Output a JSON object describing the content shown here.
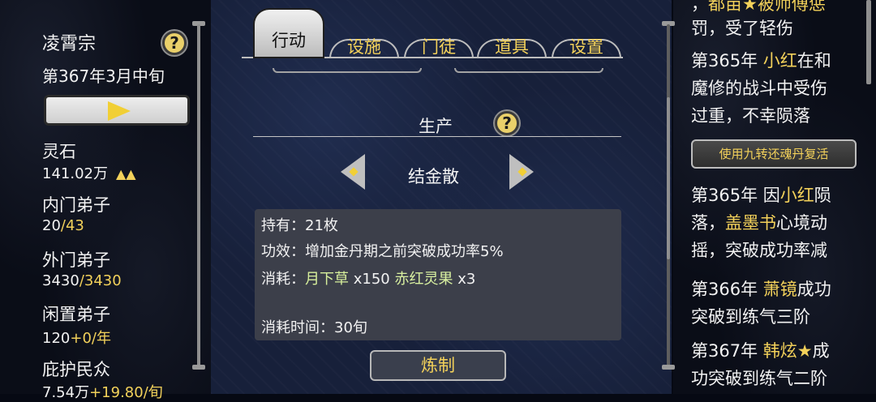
{
  "sect": {
    "name": "凌霄宗",
    "date": "第367年3月中旬"
  },
  "stats": [
    {
      "label": "灵石",
      "value": "141.02万",
      "extra": "▲▲"
    },
    {
      "label": "内门弟子",
      "value": "20",
      "value2": "/43"
    },
    {
      "label": "外门弟子",
      "value": "3430",
      "value2": "/3430"
    },
    {
      "label": "闲置弟子",
      "value": "120",
      "value2": "+0/年"
    },
    {
      "label": "庇护民众",
      "value": "7.54万",
      "value2": "+19.80/旬"
    }
  ],
  "tabs": [
    "行动",
    "设施",
    "门徒",
    "道具",
    "设置"
  ],
  "production": {
    "title": "生产",
    "item": "结金散",
    "held_label": "持有：",
    "held_value": "21枚",
    "effect_label": "功效：",
    "effect_value": "增加金丹期之前突破成功率5%",
    "cost_label": "消耗：",
    "cost_item1": "月下草",
    "cost_qty1": "x150",
    "cost_item2": "赤红灵果",
    "cost_qty2": "x3",
    "time_label": "消耗时间：",
    "time_value": "30旬",
    "craft_label": "炼制"
  },
  "log": {
    "line0_a": "，",
    "line0_b": "都亩★被师傅惩",
    "line1": "罚，受了轻伤",
    "e1_year": "第365年",
    "e1_name": "小红",
    "e1_a": "在和",
    "e1_b": "魔修的战斗中受伤",
    "e1_c": "过重，不幸陨落",
    "revive": "使用九转还魂丹复活",
    "e2_year": "第365年",
    "e2_a": "因",
    "e2_name": "小红",
    "e2_b": "陨",
    "e2_c": "落，",
    "e2_name2": "盖墨书",
    "e2_d": "心境动",
    "e2_e": "摇，突破成功率减",
    "e3_year": "第366年",
    "e3_name": "萧镜",
    "e3_a": "成功",
    "e3_b": "突破到练气三阶",
    "e4_year": "第367年",
    "e4_name": "韩炫★",
    "e4_a": "成",
    "e4_b": "功突破到练气二阶"
  }
}
